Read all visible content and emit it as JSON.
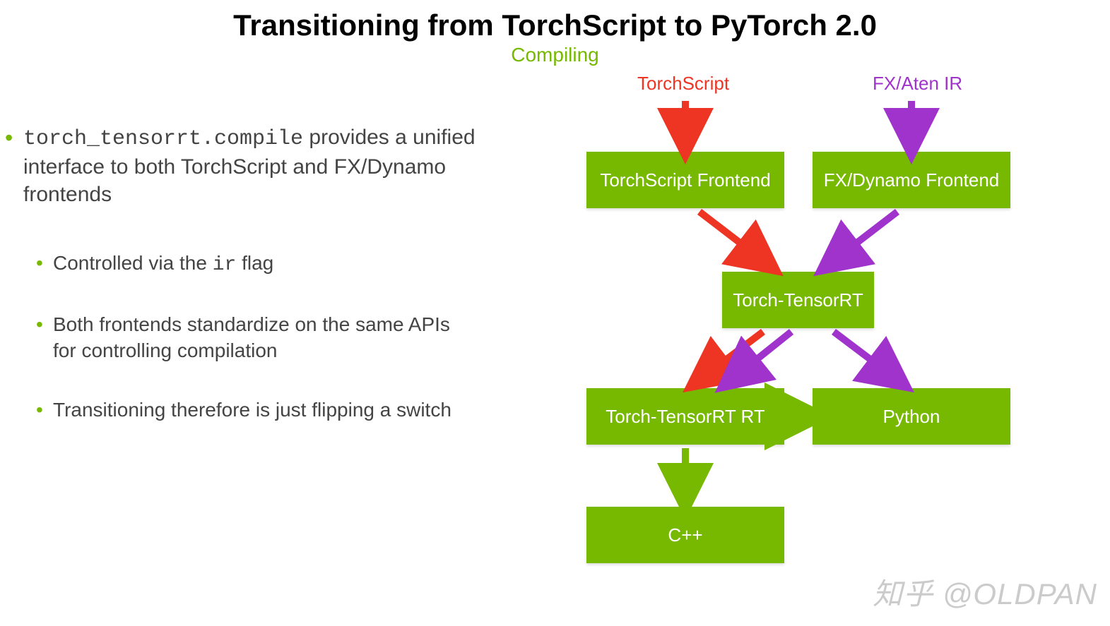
{
  "title": "Transitioning from TorchScript to PyTorch 2.0",
  "subtitle": "Compiling",
  "bullets": {
    "main_code": "torch_tensorrt.compile",
    "main_rest": " provides a unified interface to both TorchScript and FX/Dynamo frontends",
    "sub1_pre": "Controlled via the ",
    "sub1_code": "ir",
    "sub1_post": " flag",
    "sub2": "Both frontends standardize on the same APIs for controlling compilation",
    "sub3": "Transitioning therefore is just flipping a switch"
  },
  "diagram": {
    "label_left": "TorchScript",
    "label_right": "FX/Aten IR",
    "box_ts_frontend": "TorchScript Frontend",
    "box_fx_frontend": "FX/Dynamo Frontend",
    "box_trt": "Torch-TensorRT",
    "box_trt_rt": "Torch-TensorRT RT",
    "box_python": "Python",
    "box_cpp": "C++"
  },
  "colors": {
    "green": "#76b900",
    "red": "#ee3524",
    "purple": "#a033cc"
  },
  "watermark": "知乎 @OLDPAN"
}
